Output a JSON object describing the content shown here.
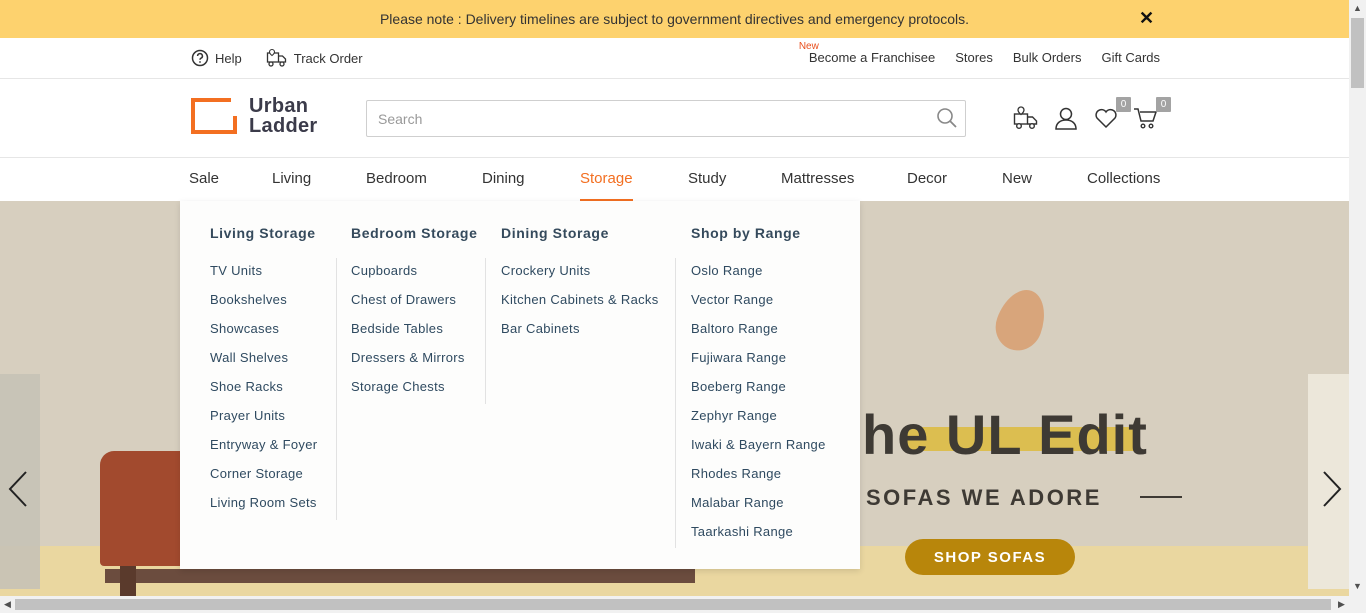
{
  "announcement": {
    "text": "Please note : Delivery timelines are subject to government directives and emergency protocols.",
    "close": "✕"
  },
  "utility": {
    "help": "Help",
    "track_order": "Track Order",
    "new_tag": "New",
    "links": [
      "Become a Franchisee",
      "Stores",
      "Bulk Orders",
      "Gift Cards"
    ]
  },
  "header": {
    "logo_line1": "Urban",
    "logo_line2": "Ladder",
    "search_placeholder": "Search",
    "wishlist_count": "0",
    "cart_count": "0"
  },
  "nav": [
    "Sale",
    "Living",
    "Bedroom",
    "Dining",
    "Storage",
    "Study",
    "Mattresses",
    "Decor",
    "New",
    "Collections"
  ],
  "active_nav": "Storage",
  "megamenu": {
    "columns": [
      {
        "title": "Living Storage",
        "items": [
          "TV Units",
          "Bookshelves",
          "Showcases",
          "Wall Shelves",
          "Shoe Racks",
          "Prayer Units",
          "Entryway & Foyer",
          "Corner Storage",
          "Living Room Sets"
        ]
      },
      {
        "title": "Bedroom Storage",
        "items": [
          "Cupboards",
          "Chest of Drawers",
          "Bedside Tables",
          "Dressers & Mirrors",
          "Storage Chests"
        ]
      },
      {
        "title": "Dining Storage",
        "items": [
          "Crockery Units",
          "Kitchen Cabinets & Racks",
          "Bar Cabinets"
        ]
      },
      {
        "title": "Shop by Range",
        "items": [
          "Oslo Range",
          "Vector Range",
          "Baltoro Range",
          "Fujiwara Range",
          "Boeberg Range",
          "Zephyr Range",
          "Iwaki & Bayern Range",
          "Rhodes Range",
          "Malabar Range",
          "Taarkashi Range"
        ]
      }
    ]
  },
  "hero": {
    "headline": "he UL Edit",
    "subline": "SOFAS WE ADORE",
    "cta": "SHOP SOFAS"
  },
  "colors": {
    "accent": "#f36f21",
    "announce_bg": "#fdd26e",
    "menu_text": "#2f4a60",
    "cta_bg": "#b8860b"
  }
}
